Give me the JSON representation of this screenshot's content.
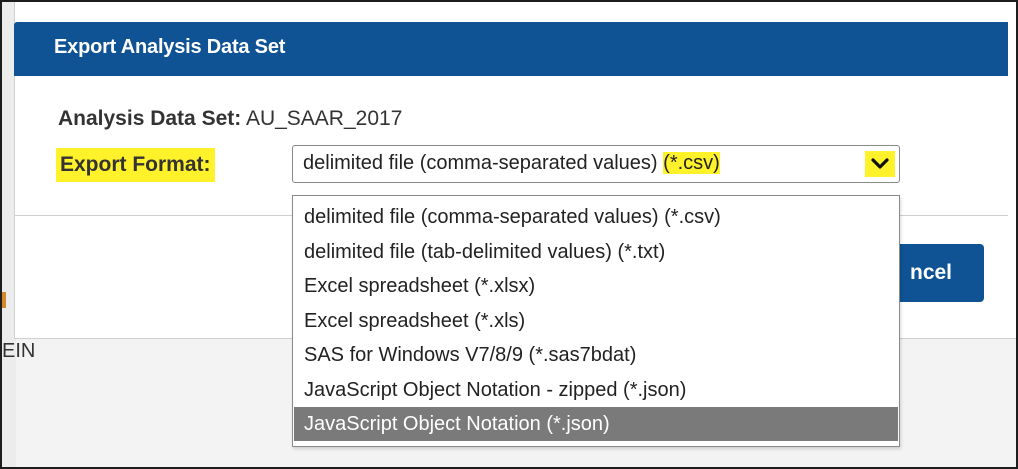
{
  "background": {
    "text": "EIN"
  },
  "dialog": {
    "title": "Export Analysis Data Set",
    "data_set_label": "Analysis Data Set:",
    "data_set_value": "AU_SAAR_2017",
    "export_format_label": "Export Format:",
    "selected_prefix": "delimited file (comma-separated values) ",
    "selected_suffix": "(*.csv)",
    "cancel_label": "Cancel",
    "cancel_visible_label": "ncel"
  },
  "dropdown": {
    "options": [
      "delimited file (comma-separated values) (*.csv)",
      "delimited file (tab-delimited values) (*.txt)",
      "Excel spreadsheet (*.xlsx)",
      "Excel spreadsheet (*.xls)",
      "SAS for Windows V7/8/9 (*.sas7bdat)",
      "JavaScript Object Notation - zipped (*.json)",
      "JavaScript Object Notation (*.json)"
    ],
    "highlighted_index": 6
  },
  "colors": {
    "header_blue": "#0f5394",
    "highlight_yellow": "#fff12a",
    "selected_gray": "#7a7a7a"
  },
  "icons": {
    "dropdown_arrow": "chevron-down-icon"
  }
}
